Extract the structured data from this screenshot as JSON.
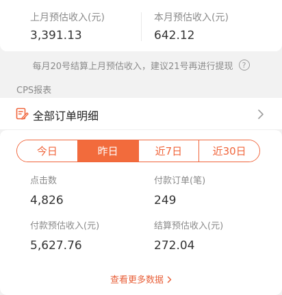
{
  "top_stats": {
    "last_month": {
      "label": "上月预估收入(元)",
      "value": "3,391.13"
    },
    "this_month": {
      "label": "本月预估收入(元)",
      "value": "642.12"
    }
  },
  "notice": {
    "text": "每月20号结算上月预估收入，建议21号再进行提现",
    "icon": "question-circle-icon"
  },
  "section_label": "CPS报表",
  "orders": {
    "title": "全部订单明细",
    "icon": "edit-document-icon",
    "chevron_icon": "chevron-right-icon"
  },
  "tabs": [
    {
      "label": "今日",
      "active": false
    },
    {
      "label": "昨日",
      "active": true
    },
    {
      "label": "近7日",
      "active": false
    },
    {
      "label": "近30日",
      "active": false
    }
  ],
  "stats": {
    "clicks": {
      "label": "点击数",
      "value": "4,826"
    },
    "paid_orders": {
      "label": "付款订单(笔)",
      "value": "249"
    },
    "paid_income": {
      "label": "付款预估收入(元)",
      "value": "5,627.76"
    },
    "settled_income": {
      "label": "结算预估收入(元)",
      "value": "272.04"
    }
  },
  "more_link": {
    "label": "查看更多数据",
    "icon": "chevron-right-icon"
  },
  "colors": {
    "accent": "#f26b3c",
    "text_secondary": "#8a8a8a",
    "background": "#f2f2f2"
  }
}
